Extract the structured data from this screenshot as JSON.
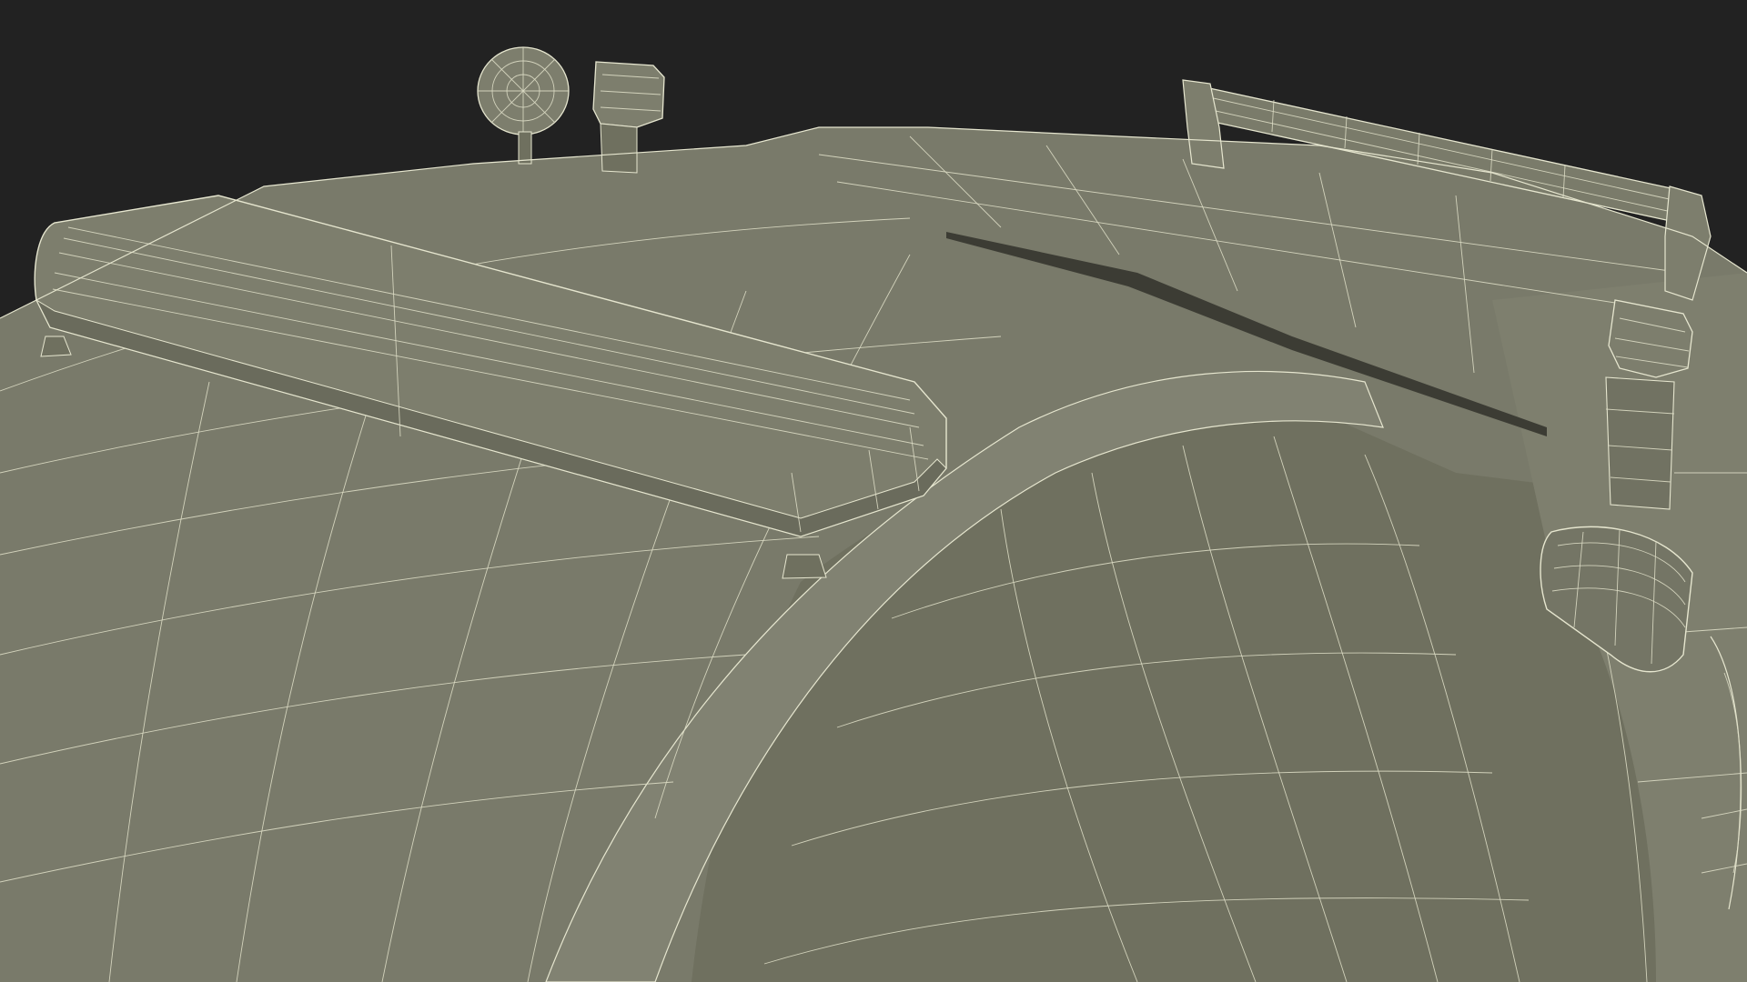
{
  "scene": {
    "subject": "wireframe-render",
    "colors": {
      "background": "#222222",
      "surface": "#797a6a",
      "surface_dark": "#6c6d5e",
      "surface_light": "#868776",
      "wire": "#e6e6cf",
      "gap": "#3c3c34"
    }
  }
}
